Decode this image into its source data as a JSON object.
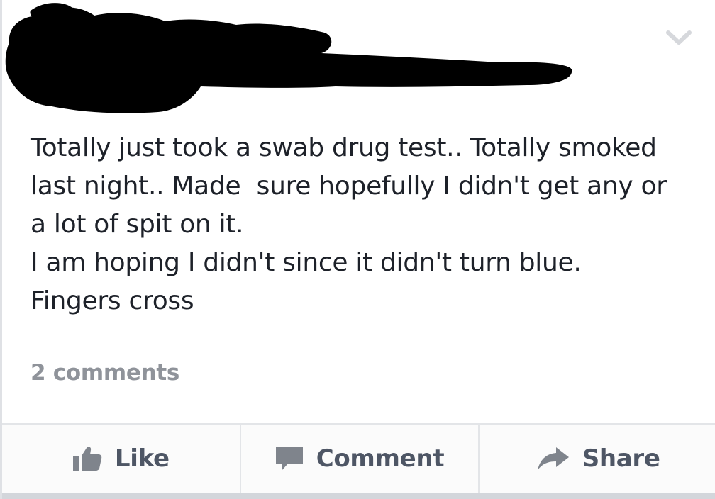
{
  "post": {
    "text_lines": [
      "Totally just took a swab drug test.. Totally smoked",
      "last night.. Made  sure hopefully I didn't get any or",
      "a lot of spit on it.",
      "I am hoping I didn't since it didn't turn blue.",
      "Fingers cross"
    ],
    "comments_count": "2 comments"
  },
  "actions": {
    "like_label": "Like",
    "comment_label": "Comment",
    "share_label": "Share"
  },
  "icons": {
    "menu": "chevron-down-icon",
    "like": "thumbs-up-icon",
    "comment": "speech-bubble-icon",
    "share": "share-arrow-icon"
  },
  "colors": {
    "text": "#1d2129",
    "muted": "#8f939a",
    "action_text": "#4e5665",
    "icon": "#7f848c",
    "divider": "#e3e5e8"
  }
}
